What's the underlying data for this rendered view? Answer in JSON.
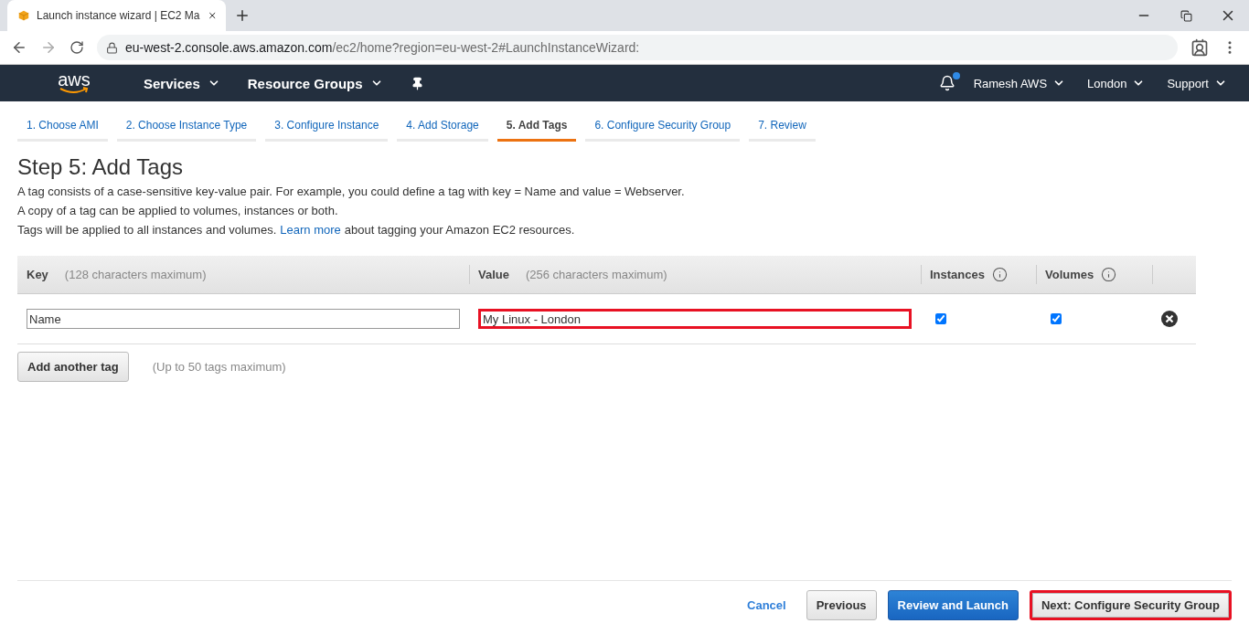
{
  "browser": {
    "tab_title": "Launch instance wizard | EC2 Ma",
    "address_host": "eu-west-2.console.aws.amazon.com",
    "address_path": "/ec2/home?region=eu-west-2#LaunchInstanceWizard:"
  },
  "nav": {
    "logo": "aws",
    "menus": [
      {
        "label": "Services",
        "dropdown": true
      },
      {
        "label": "Resource Groups",
        "dropdown": true
      }
    ],
    "notification": true,
    "right_menus": [
      {
        "label": "Ramesh AWS",
        "dropdown": true
      },
      {
        "label": "London",
        "dropdown": true
      },
      {
        "label": "Support",
        "dropdown": true
      }
    ]
  },
  "steps": [
    {
      "label": "1. Choose AMI",
      "selected": false
    },
    {
      "label": "2. Choose Instance Type",
      "selected": false
    },
    {
      "label": "3. Configure Instance",
      "selected": false
    },
    {
      "label": "4. Add Storage",
      "selected": false
    },
    {
      "label": "5. Add Tags",
      "selected": true
    },
    {
      "label": "6. Configure Security Group",
      "selected": false
    },
    {
      "label": "7. Review",
      "selected": false
    }
  ],
  "heading": "Step 5: Add Tags",
  "paragraphs": [
    {
      "text": "A tag consists of a case-sensitive key-value pair. For example, you could define a tag with key = Name and value = Webserver."
    },
    {
      "text": "A copy of a tag can be applied to volumes, instances or both."
    },
    {
      "text": "Tags will be applied to all instances and volumes.",
      "link": "Learn more",
      "after": "about tagging your Amazon EC2 resources."
    }
  ],
  "table": {
    "columns": [
      {
        "label": "Key",
        "hint": "(128 characters maximum)",
        "info": false
      },
      {
        "label": "Value",
        "hint": "(256 characters maximum)",
        "info": false
      },
      {
        "label": "Instances",
        "info": true
      },
      {
        "label": "Volumes",
        "info": true
      }
    ],
    "rows": [
      {
        "key": "Name",
        "value": "My Linux - London",
        "value_highlighted": true,
        "instances": true,
        "volumes": true
      }
    ]
  },
  "add_button": "Add another tag",
  "add_hint": "(Up to 50 tags maximum)",
  "footer": [
    {
      "label": "Cancel",
      "kind": "link",
      "highlighted": false
    },
    {
      "label": "Previous",
      "kind": "default",
      "highlighted": false
    },
    {
      "label": "Review and Launch",
      "kind": "primary",
      "highlighted": false
    },
    {
      "label": "Next: Configure Security Group",
      "kind": "default",
      "highlighted": true
    }
  ]
}
